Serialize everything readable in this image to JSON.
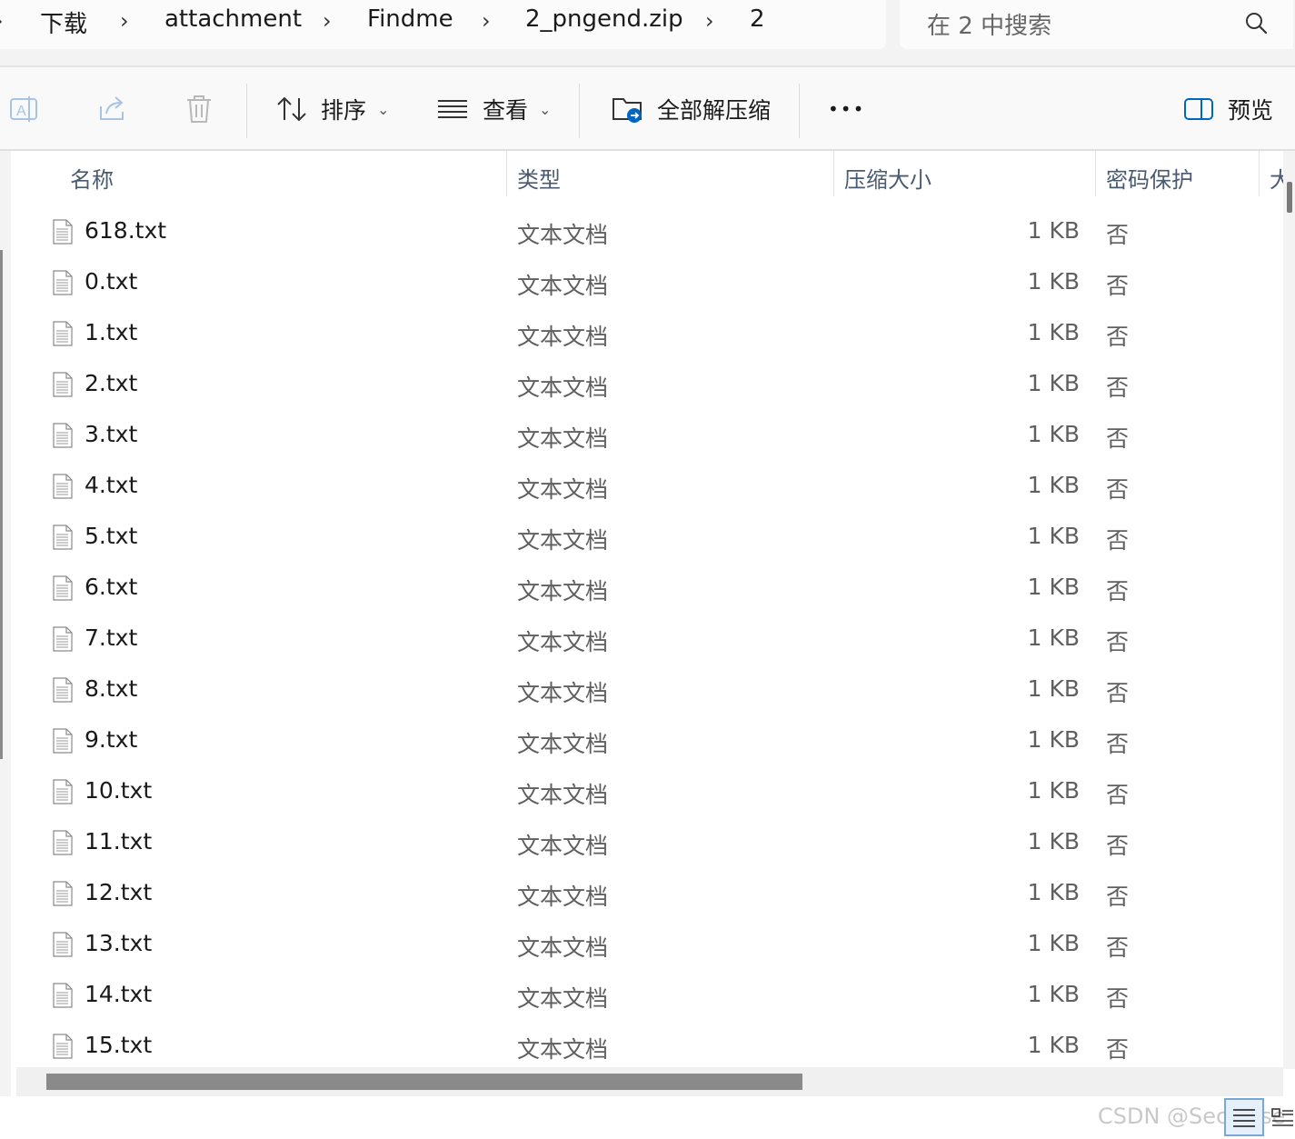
{
  "breadcrumb": {
    "items": [
      "下载",
      "attachment",
      "Findme",
      "2_pngend.zip",
      "2"
    ],
    "separator": "›"
  },
  "search": {
    "placeholder": "在 2 中搜索",
    "icon": "search-icon"
  },
  "toolbar": {
    "sort_label": "排序",
    "view_label": "查看",
    "extract_all_label": "全部解压缩",
    "more_label": "•••",
    "preview_label": "预览",
    "icons": [
      "rename-icon",
      "share-icon",
      "delete-icon",
      "sort-icon",
      "view-icon",
      "extract-icon",
      "more-icon",
      "preview-pane-icon"
    ],
    "accent_color": "#0067c0"
  },
  "columns": {
    "name": "名称",
    "type": "类型",
    "compressed_size": "压缩大小",
    "password": "密码保护",
    "size_partial": "大"
  },
  "files": [
    {
      "name": "618.txt",
      "type": "文本文档",
      "size": "1 KB",
      "password": "否"
    },
    {
      "name": "0.txt",
      "type": "文本文档",
      "size": "1 KB",
      "password": "否"
    },
    {
      "name": "1.txt",
      "type": "文本文档",
      "size": "1 KB",
      "password": "否"
    },
    {
      "name": "2.txt",
      "type": "文本文档",
      "size": "1 KB",
      "password": "否"
    },
    {
      "name": "3.txt",
      "type": "文本文档",
      "size": "1 KB",
      "password": "否"
    },
    {
      "name": "4.txt",
      "type": "文本文档",
      "size": "1 KB",
      "password": "否"
    },
    {
      "name": "5.txt",
      "type": "文本文档",
      "size": "1 KB",
      "password": "否"
    },
    {
      "name": "6.txt",
      "type": "文本文档",
      "size": "1 KB",
      "password": "否"
    },
    {
      "name": "7.txt",
      "type": "文本文档",
      "size": "1 KB",
      "password": "否"
    },
    {
      "name": "8.txt",
      "type": "文本文档",
      "size": "1 KB",
      "password": "否"
    },
    {
      "name": "9.txt",
      "type": "文本文档",
      "size": "1 KB",
      "password": "否"
    },
    {
      "name": "10.txt",
      "type": "文本文档",
      "size": "1 KB",
      "password": "否"
    },
    {
      "name": "11.txt",
      "type": "文本文档",
      "size": "1 KB",
      "password": "否"
    },
    {
      "name": "12.txt",
      "type": "文本文档",
      "size": "1 KB",
      "password": "否"
    },
    {
      "name": "13.txt",
      "type": "文本文档",
      "size": "1 KB",
      "password": "否"
    },
    {
      "name": "14.txt",
      "type": "文本文档",
      "size": "1 KB",
      "password": "否"
    },
    {
      "name": "15.txt",
      "type": "文本文档",
      "size": "1 KB",
      "password": "否"
    }
  ],
  "watermark": "CSDN @SecPulse"
}
